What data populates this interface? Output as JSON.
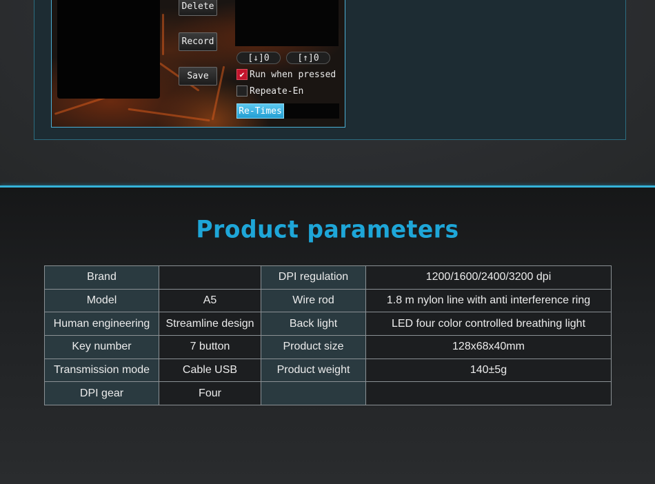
{
  "macro_editor": {
    "buttons": {
      "delete_label": "Delete",
      "record_label": "Record",
      "save_label": "Save"
    },
    "key_down_counter": "[↓]0",
    "key_up_counter": "[↑]0",
    "run_when_pressed": {
      "label": "Run when pressed",
      "checked": true
    },
    "repeat_enable": {
      "label": "Repeate-En",
      "checked": false
    },
    "retimes_label": "Re-Times",
    "retimes_value": ""
  },
  "params": {
    "title": "Product parameters",
    "rows": [
      {
        "label1": "Brand",
        "value1": "",
        "label2": "DPI regulation",
        "value2": "1200/1600/2400/3200 dpi"
      },
      {
        "label1": "Model",
        "value1": "A5",
        "label2": "Wire rod",
        "value2": "1.8 m nylon line with anti interference ring"
      },
      {
        "label1": "Human engineering",
        "value1": "Streamline design",
        "label2": "Back light",
        "value2": "LED four color controlled breathing light"
      },
      {
        "label1": "Key number",
        "value1": "7 button",
        "label2": "Product size",
        "value2": "128x68x40mm"
      },
      {
        "label1": "Transmission mode",
        "value1": "Cable USB",
        "label2": "Product weight",
        "value2": "140±5g"
      },
      {
        "label1": "DPI gear",
        "value1": "Four",
        "label2": "",
        "value2": ""
      }
    ]
  },
  "colors": {
    "accent": "#1ea6d8",
    "label_cell_bg": "#2a3a40",
    "checkbox_checked": "#c2142c"
  }
}
